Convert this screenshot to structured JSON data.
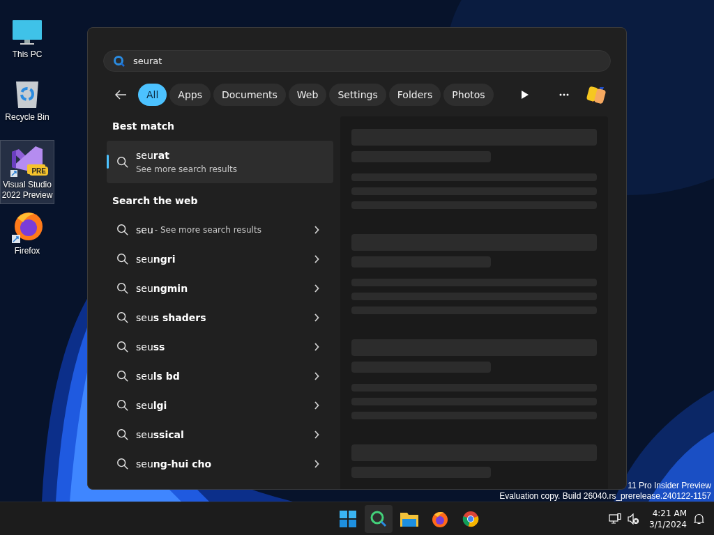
{
  "desktop_icons": [
    {
      "label": "This PC",
      "kind": "monitor",
      "selected": false
    },
    {
      "label": "Recycle Bin",
      "kind": "bin",
      "selected": false
    },
    {
      "label": "Visual Studio 2022 Preview",
      "kind": "vs",
      "badge": "PRE",
      "selected": true
    },
    {
      "label": "Firefox",
      "kind": "firefox",
      "selected": false
    }
  ],
  "search": {
    "value": "seurat"
  },
  "filters": [
    {
      "label": "All",
      "selected": true
    },
    {
      "label": "Apps",
      "selected": false
    },
    {
      "label": "Documents",
      "selected": false
    },
    {
      "label": "Web",
      "selected": false
    },
    {
      "label": "Settings",
      "selected": false
    },
    {
      "label": "Folders",
      "selected": false
    },
    {
      "label": "Photos",
      "selected": false
    }
  ],
  "best_match": {
    "heading": "Best match",
    "title": "seu**rat**",
    "subtitle": "See more search results",
    "selected": true
  },
  "web": {
    "heading": "Search the web",
    "items": [
      {
        "text": "seu",
        "hint": " - See more search results"
      },
      {
        "text": "seu**ngri**"
      },
      {
        "text": "seu**ngmin**"
      },
      {
        "text": "seu**s shaders**"
      },
      {
        "text": "seu**ss**"
      },
      {
        "text": "seu**ls bd**"
      },
      {
        "text": "seu**lgi**"
      },
      {
        "text": "seu**ssical**"
      },
      {
        "text": "seu**ng-hui cho**"
      }
    ]
  },
  "watermark": [
    "11 Pro Insider Preview",
    "Evaluation copy. Build 26040.rs_prerelease.240122-1157"
  ],
  "taskbar": {
    "apps": [
      {
        "kind": "start",
        "selected": false
      },
      {
        "kind": "search",
        "selected": true
      },
      {
        "kind": "explorer",
        "selected": false
      },
      {
        "kind": "firefox",
        "selected": false
      },
      {
        "kind": "chrome",
        "selected": false
      }
    ],
    "time": "4:21 AM",
    "date": "3/1/2024"
  }
}
